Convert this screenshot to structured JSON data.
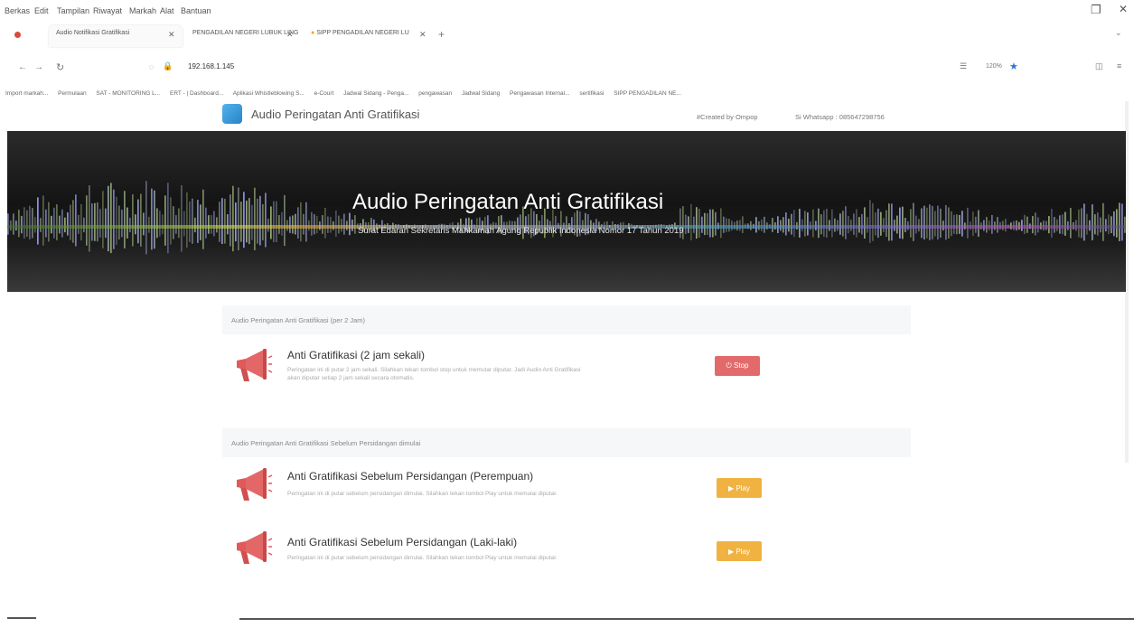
{
  "browser": {
    "menu": [
      "Berkas",
      "Edit",
      "Tampilan",
      "Riwayat",
      "Markah",
      "Alat",
      "Bantuan"
    ],
    "tabs": [
      {
        "label": "Audio Notifikasi Gratifikasi"
      },
      {
        "label": "PENGADILAN NEGERI LUBUK LING"
      },
      {
        "label": "SIPP PENGADILAN NEGERI LU"
      }
    ],
    "address": "192.168.1.145",
    "zoom": "120%",
    "bookmarks": [
      "Import markah...",
      "Permulaan",
      "SAT - MONITORING L...",
      "ERT - | Dashboard...",
      "Aplikasi Whistleblowing S...",
      "e-Court",
      "Jadwal Sidang - Penga...",
      "pengawasan",
      "Jadwal Sidang",
      "Pengawasan Internal...",
      "sertifikasi",
      "SIPP PENGADILAN NE..."
    ]
  },
  "site": {
    "title": "Audio Peringatan Anti Gratifikasi",
    "created_by": "#Created by Ompop",
    "whatsapp": "Si Whatsapp : 085647298756"
  },
  "hero": {
    "title": "Audio Peringatan Anti Gratifikasi",
    "subtitle": "Surat Edaran Sekretaris Mahkamah Agung Republik Indonesia Nomor 17 Tahun 2019"
  },
  "sections": [
    {
      "header": "Audio Peringatan Anti Gratifikasi (per 2 Jam)",
      "items": [
        {
          "title": "Anti Gratifikasi (2 jam sekali)",
          "desc": "Peringatan ini di putar 2 jam sekali. Silahkan tekan tombol stop untuk memutar diputar. Jadi Audio Anti Gratifikasi akan diputar setiap 2 jam sekali secara otomatis.",
          "button": "Stop",
          "button_icon": "⏻",
          "button_kind": "stop"
        }
      ]
    },
    {
      "header": "Audio Peringatan Anti Gratifikasi Sebelum Persidangan dimulai",
      "items": [
        {
          "title": "Anti Gratifikasi Sebelum Persidangan (Perempuan)",
          "desc": "Peringatan ini di putar sebelum persidangan dimulai. Silahkan tekan tombol Play untuk memulai diputar.",
          "button": "Play",
          "button_icon": "▶",
          "button_kind": "play"
        },
        {
          "title": "Anti Gratifikasi Sebelum Persidangan (Laki-laki)",
          "desc": "Peringatan ini di putar sebelum persidangan dimulai. Silahkan tekan tombol Play untuk memulai diputar.",
          "button": "Play",
          "button_icon": "▶",
          "button_kind": "play"
        }
      ]
    }
  ],
  "colors": {
    "stop": "#e36a6a",
    "play": "#f0b341",
    "megaphone": "#e05a5a",
    "logo": "#3a9be0"
  }
}
